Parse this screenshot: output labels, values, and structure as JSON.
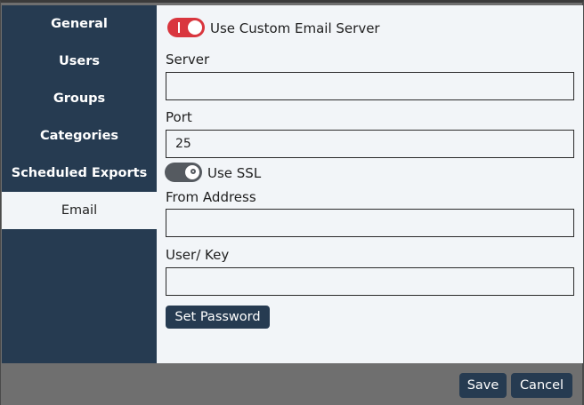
{
  "sidebar": {
    "items": [
      {
        "label": "General"
      },
      {
        "label": "Users"
      },
      {
        "label": "Groups"
      },
      {
        "label": "Categories"
      },
      {
        "label": "Scheduled Exports"
      },
      {
        "label": "Email"
      }
    ],
    "active": "Email"
  },
  "email": {
    "custom_server_toggle": {
      "label": "Use Custom Email Server",
      "checked": true
    },
    "server": {
      "label": "Server",
      "value": ""
    },
    "port": {
      "label": "Port",
      "value": "25"
    },
    "ssl_toggle": {
      "label": "Use SSL",
      "checked": false
    },
    "from_address": {
      "label": "From Address",
      "value": ""
    },
    "user_key": {
      "label": "User/ Key",
      "value": ""
    },
    "set_password_label": "Set Password"
  },
  "footer": {
    "save_label": "Save",
    "cancel_label": "Cancel"
  },
  "colors": {
    "sidebar": "#263b51",
    "toggle_on": "#d9363e",
    "toggle_off": "#555a60",
    "content_bg": "#f2f5f8",
    "footer_bg": "#6f6f6f"
  }
}
